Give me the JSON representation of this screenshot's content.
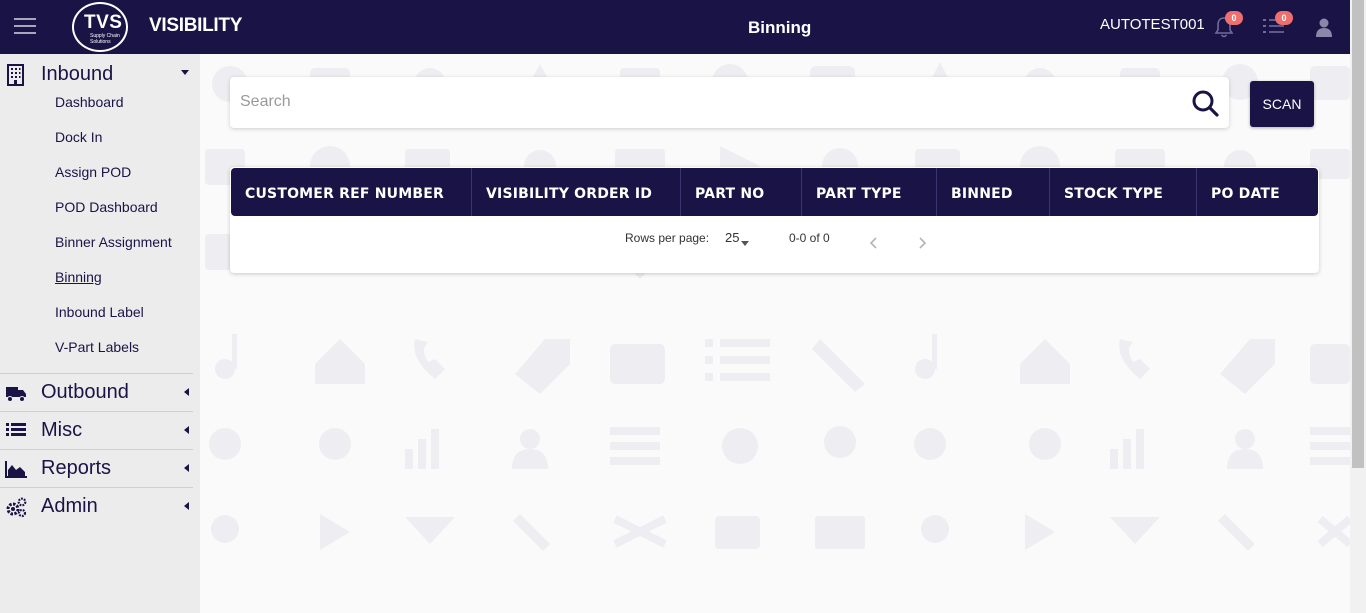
{
  "header": {
    "logo_text": "TVS",
    "logo_subtext": "Supply Chain Solutions",
    "brand": "VISIBILITY",
    "page_title": "Binning",
    "username": "AUTOTEST001",
    "notifications_count": "0",
    "tasks_count": "0",
    "icons": [
      "menu-icon",
      "bell-icon",
      "list-icon",
      "user-icon"
    ]
  },
  "sidebar": {
    "inbound": {
      "label": "Inbound",
      "icon": "building-icon",
      "items": [
        "Dashboard",
        "Dock In",
        "Assign POD",
        "POD Dashboard",
        "Binner Assignment",
        "Binning",
        "Inbound Label",
        "V-Part Labels"
      ],
      "active": "Binning"
    },
    "outbound": {
      "label": "Outbound",
      "icon": "truck-icon"
    },
    "misc": {
      "label": "Misc",
      "icon": "list-icon"
    },
    "reports": {
      "label": "Reports",
      "icon": "area-chart-icon"
    },
    "admin": {
      "label": "Admin",
      "icon": "cogs-icon"
    }
  },
  "search": {
    "placeholder": "Search",
    "value": ""
  },
  "scan_button": "SCAN",
  "table": {
    "columns": [
      "CUSTOMER REF NUMBER",
      "VISIBILITY ORDER ID",
      "PART NO",
      "PART TYPE",
      "BINNED",
      "STOCK TYPE",
      "PO DATE"
    ],
    "rows": []
  },
  "pagination": {
    "rows_per_page_label": "Rows per page:",
    "rows_per_page": "25",
    "range": "0-0 of 0"
  },
  "colors": {
    "primary": "#1a1446",
    "badge": "#ef6f6f",
    "sidebar_bg": "#ececec"
  }
}
